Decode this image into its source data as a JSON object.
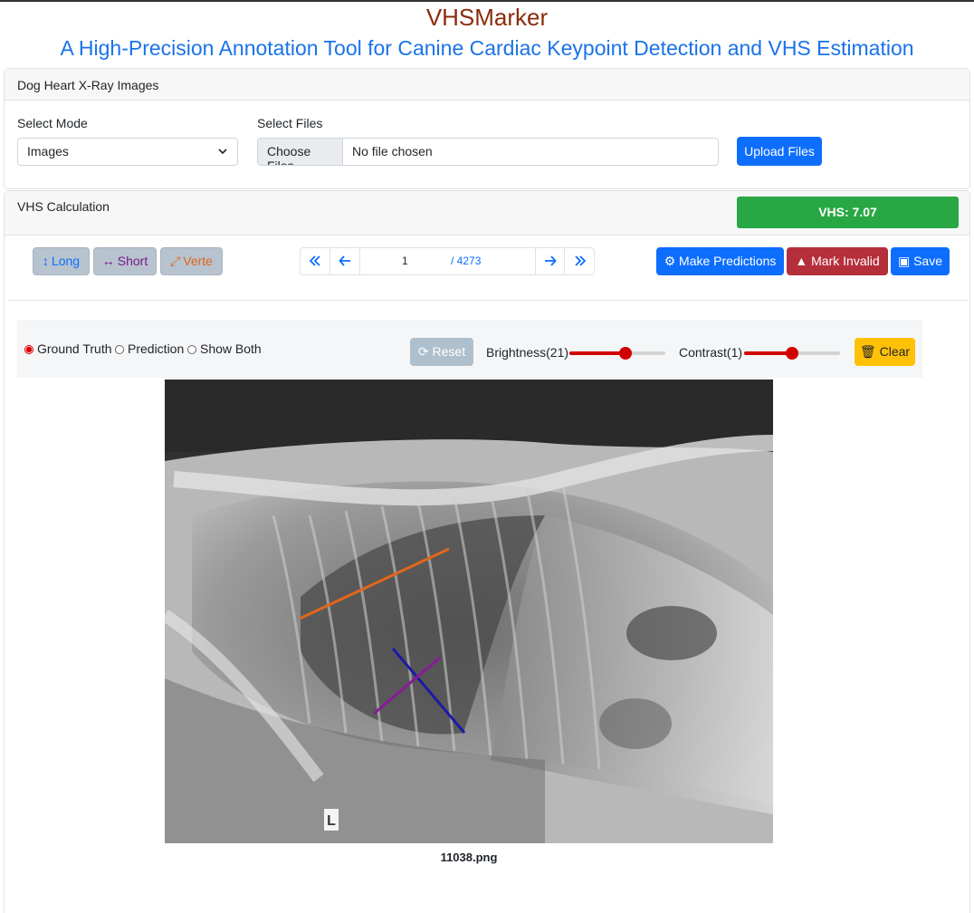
{
  "header": {
    "title": "VHSMarker",
    "subtitle": "A High-Precision Annotation Tool for Canine Cardiac Keypoint Detection and VHS Estimation"
  },
  "upload": {
    "card_title": "Dog Heart X-Ray Images",
    "mode_label": "Select Mode",
    "mode_value": "Images",
    "files_label": "Select Files",
    "choose_label": "Choose Files",
    "file_status": "No file chosen",
    "upload_label": "Upload Files"
  },
  "vhs": {
    "card_title": "VHS Calculation",
    "badge": "VHS: 7.07",
    "tools": {
      "long": "Long",
      "short": "Short",
      "verte": "Verte"
    },
    "pager": {
      "current": "1",
      "total": "/ 4273"
    },
    "actions": {
      "predict": "Make Predictions",
      "invalid": "Mark Invalid",
      "save": "Save"
    },
    "view": {
      "options": [
        "Ground Truth",
        "Prediction",
        "Show Both"
      ],
      "selected": "Ground Truth",
      "reset": "Reset",
      "brightness_label": "Brightness(21)",
      "brightness_level": 0.6,
      "contrast_label": "Contrast(1)",
      "contrast_level": 0.5,
      "clear": "Clear"
    },
    "image": {
      "marker": "L",
      "filename": "11038.png"
    }
  },
  "colors": {
    "title": "#8b2c0a",
    "subtitle": "#1a73e8",
    "vhs_badge": "#28a745",
    "long_line": "#1a1aa8",
    "short_line": "#8a1a9a",
    "verte_line": "#e0671a"
  }
}
